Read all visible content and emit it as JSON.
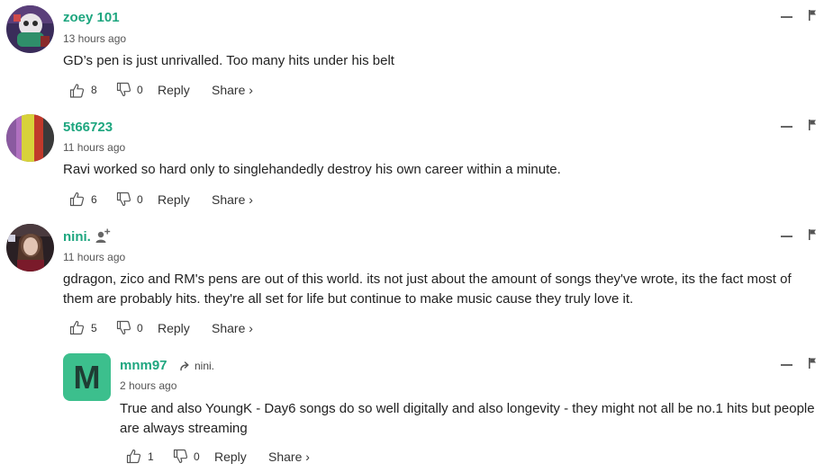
{
  "comments": [
    {
      "username": "zoey 101",
      "time": "13 hours ago",
      "text": "GD’s pen is just unrivalled. Too many hits under his belt",
      "likes": "8",
      "dislikes": "0",
      "reply_label": "Reply",
      "share_label": "Share ›"
    },
    {
      "username": "5t66723",
      "time": "11 hours ago",
      "text": "Ravi worked so hard only to singlehandedly destroy his own career within a minute.",
      "likes": "6",
      "dislikes": "0",
      "reply_label": "Reply",
      "share_label": "Share ›"
    },
    {
      "username": "nini.",
      "time": "11 hours ago",
      "text": "gdragon, zico and RM's pens are out of this world. its not just about the amount of songs they've wrote, its the fact most of them are probably hits. they're all set for life but continue to make music cause they truly love it.",
      "likes": "5",
      "dislikes": "0",
      "reply_label": "Reply",
      "share_label": "Share ›"
    },
    {
      "username": "mnm97",
      "avatar_letter": "M",
      "reply_to": "nini.",
      "time": "2 hours ago",
      "text": "True and also YoungK - Day6 songs do so well digitally and also longevity - they might not all be no.1 hits but people are always streaming",
      "likes": "1",
      "dislikes": "0",
      "reply_label": "Reply",
      "share_label": "Share ›"
    }
  ],
  "colors": {
    "username": "#1ea67f",
    "letter_avatar_bg": "#3cbf8d",
    "letter_avatar_fg": "#1f3d34"
  }
}
